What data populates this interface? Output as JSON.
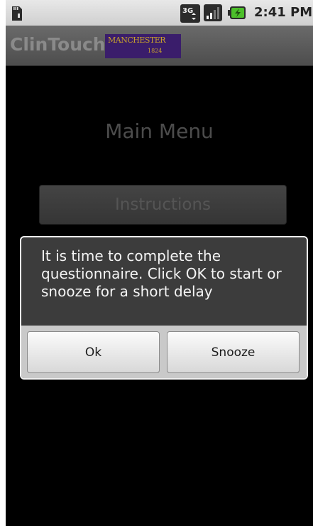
{
  "status_bar": {
    "time": "2:41 PM",
    "icons": [
      "sd-card-icon",
      "3g-data-icon",
      "signal-strength-icon",
      "battery-charging-icon"
    ],
    "network_label": "3G"
  },
  "app": {
    "title": "ClinTouch",
    "logo_text": "MANCHESTER",
    "logo_year": "1824",
    "logo_colors": {
      "background": "#3a1d6b",
      "text": "#c9a22c"
    }
  },
  "main": {
    "heading": "Main Menu",
    "buttons": [
      {
        "label": "Instructions"
      },
      {
        "label": ""
      }
    ]
  },
  "dialog": {
    "message": "It is time to complete the questionnaire. Click OK to start or snooze for a short delay",
    "ok_label": "Ok",
    "snooze_label": "Snooze"
  }
}
